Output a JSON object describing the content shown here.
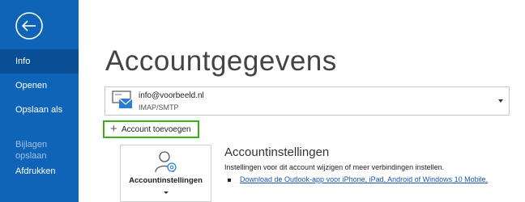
{
  "sidebar": {
    "items": [
      {
        "label": "Info",
        "active": true
      },
      {
        "label": "Openen"
      },
      {
        "label": "Opslaan als"
      },
      {
        "label": "Bijlagen\nopslaan",
        "disabled": true
      },
      {
        "label": "Afdrukken"
      }
    ],
    "back_icon": "back-arrow-icon"
  },
  "main": {
    "title": "Accountgegevens",
    "account": {
      "email": "info@voorbeeld.nl",
      "type": "IMAP/SMTP"
    },
    "add_account_label": "Account toevoegen",
    "settings_tile_label": "Accountinstellingen",
    "section": {
      "title": "Accountinstellingen",
      "description": "Instellingen voor dit account wijzigen of meer verbindingen instellen.",
      "link": "Download de Outlook-app voor iPhone, iPad, Android of Windows 10 Mobile."
    }
  },
  "colors": {
    "sidebar": "#0f64b8",
    "sidebar_active": "#0a4f96",
    "highlight": "#37b01c",
    "link": "#1a56b0"
  }
}
